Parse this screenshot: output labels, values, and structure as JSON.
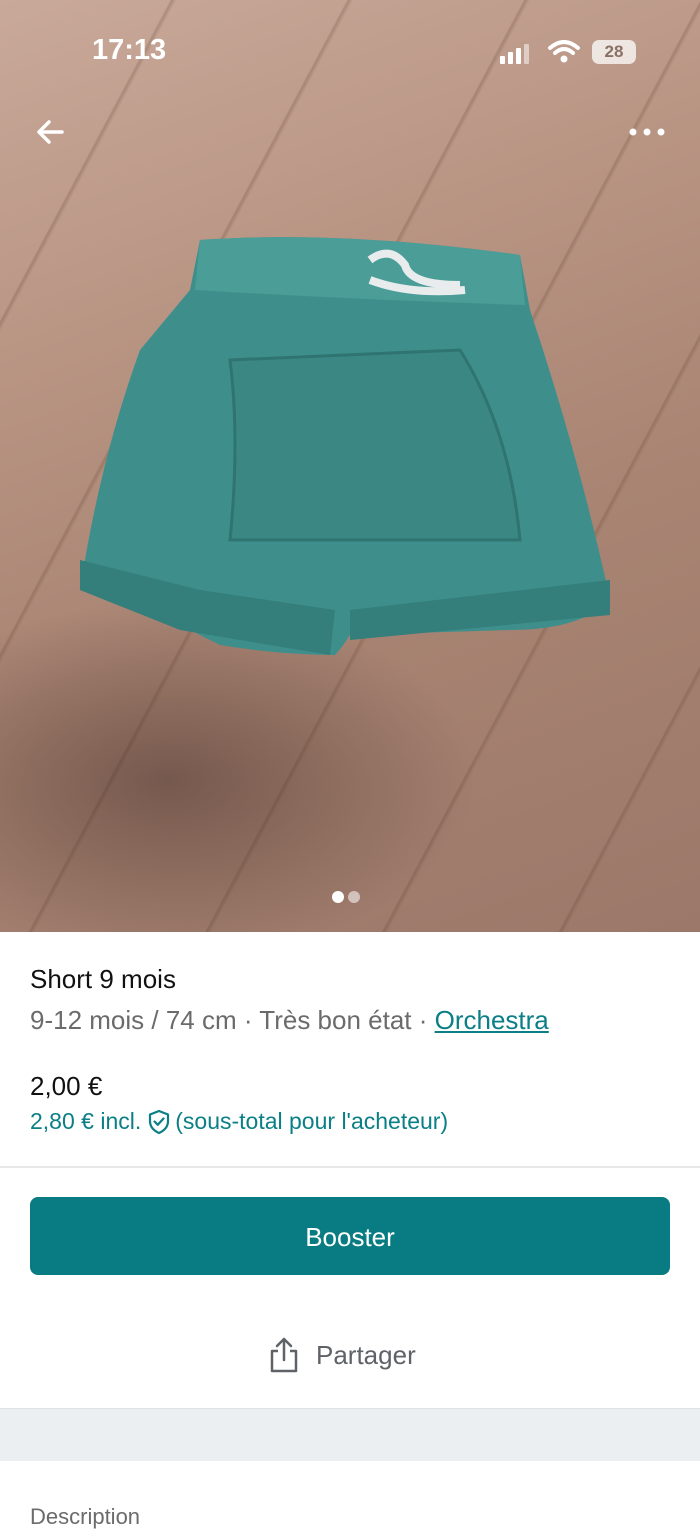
{
  "status_bar": {
    "time": "17:13",
    "battery": "28"
  },
  "item": {
    "title": "Short 9 mois",
    "size": "9-12 mois / 74 cm",
    "separator": " · ",
    "condition": "Très bon état",
    "brand": "Orchestra",
    "price": "2,00 €",
    "price_incl": "2,80 € incl.",
    "price_note": "(sous-total pour l'acheteur)"
  },
  "gallery": {
    "current_index": 1,
    "total": 2
  },
  "actions": {
    "booster_label": "Booster",
    "share_label": "Partager"
  },
  "sections": {
    "description_label": "Description"
  },
  "colors": {
    "accent": "#087c82",
    "link": "#0a7f86",
    "muted_text": "#6b6b6b"
  },
  "icons": [
    "back-arrow-icon",
    "more-icon",
    "cellular-signal-icon",
    "wifi-icon",
    "battery-icon",
    "shield-check-icon",
    "share-icon"
  ]
}
